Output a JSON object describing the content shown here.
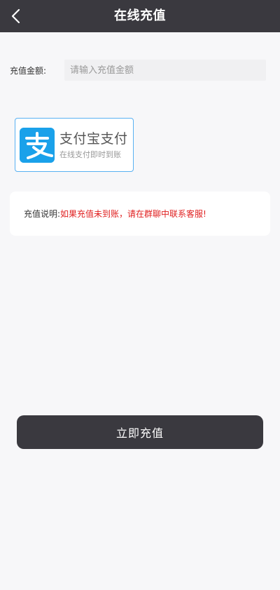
{
  "header": {
    "title": "在线充值",
    "back_icon": "chevron-left-icon"
  },
  "amount": {
    "label": "充值金额:",
    "placeholder": "请输入充值金额",
    "value": ""
  },
  "payment": {
    "name": "支付宝支付",
    "subtitle": "在线支付即时到账",
    "icon": "alipay-icon",
    "icon_glyph": "支",
    "brand_color": "#1aa1ea",
    "border_color": "#59b1f2"
  },
  "note": {
    "label": "充值说明:",
    "text": "如果充值未到账，请在群聊中联系客服!",
    "text_color": "#e02020"
  },
  "submit": {
    "label": "立即充值"
  },
  "colors": {
    "header_bg": "#3a393f",
    "page_bg": "#f7f7f9"
  }
}
